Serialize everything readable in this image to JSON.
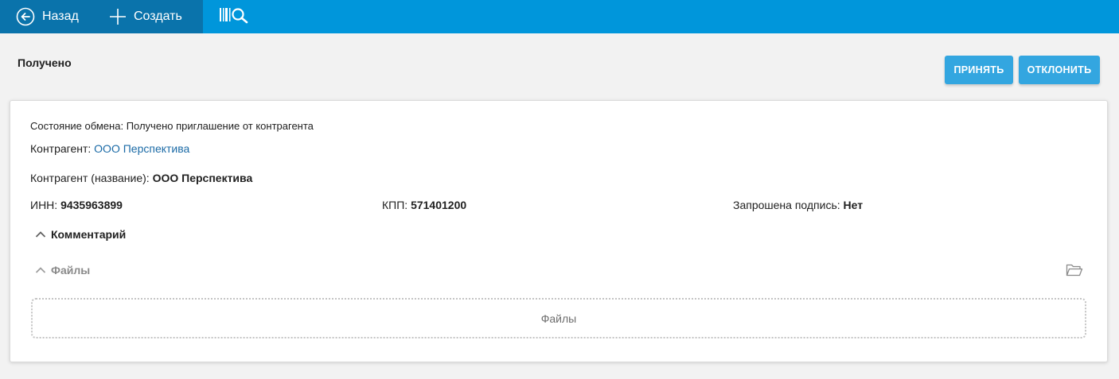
{
  "toolbar": {
    "back_label": "Назад",
    "create_label": "Создать",
    "back_icon": "arrow-left-circle-icon",
    "create_icon": "plus-icon",
    "barcode_icon": "barcode-search-icon",
    "colors": {
      "bar": "#0096db",
      "bar_dark": "#0a73ab"
    }
  },
  "header": {
    "status": "Получено",
    "accept_label": "ПРИНЯТЬ",
    "decline_label": "ОТКЛОНИТЬ",
    "button_color": "#33a6e0"
  },
  "details": {
    "exchange_state_label": "Состояние обмена:",
    "exchange_state_value": "Получено приглашение от контрагента",
    "counterparty_label": "Контрагент:",
    "counterparty_link": "ООО Перспектива",
    "counterparty_name_label": "Контрагент (название):",
    "counterparty_name_value": "ООО Перспектива",
    "inn_label": "ИНН:",
    "inn_value": "9435963899",
    "kpp_label": "КПП:",
    "kpp_value": "571401200",
    "signature_label": "Запрошена подпись:",
    "signature_value": "Нет"
  },
  "sections": {
    "comment_label": "Комментарий",
    "files_label": "Файлы",
    "dropzone_text": "Файлы",
    "folder_icon": "folder-open-icon"
  }
}
